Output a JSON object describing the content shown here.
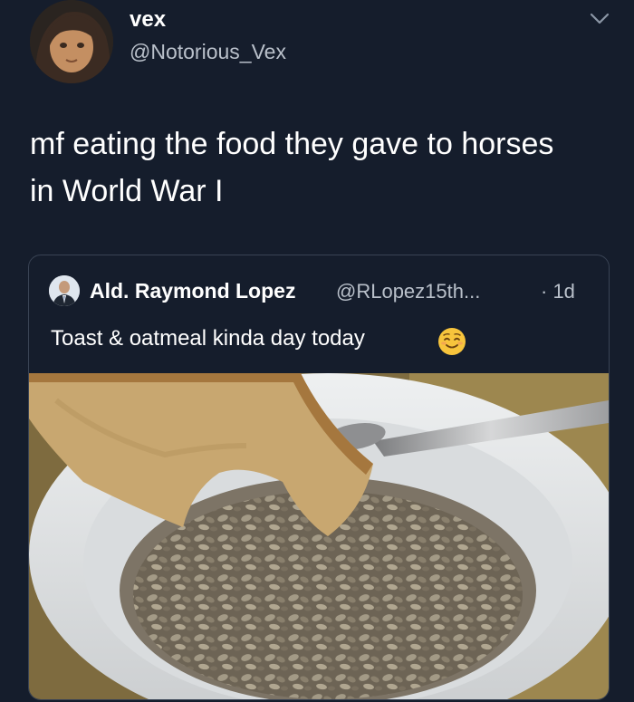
{
  "tweet": {
    "display_name": "vex",
    "handle": "@Notorious_Vex",
    "text_line1": "mf eating the food they gave to horses",
    "text_line2": "in World War I"
  },
  "quote": {
    "name": "Ald. Raymond Lopez",
    "handle": "@RLopez15th...",
    "time": "· 1d",
    "text": "Toast & oatmeal kinda day today",
    "emoji": "relieved-face-icon"
  },
  "colors": {
    "background": "#151d2c",
    "text_primary": "#ffffff",
    "text_secondary": "#b9c0ca",
    "border": "#394354"
  }
}
